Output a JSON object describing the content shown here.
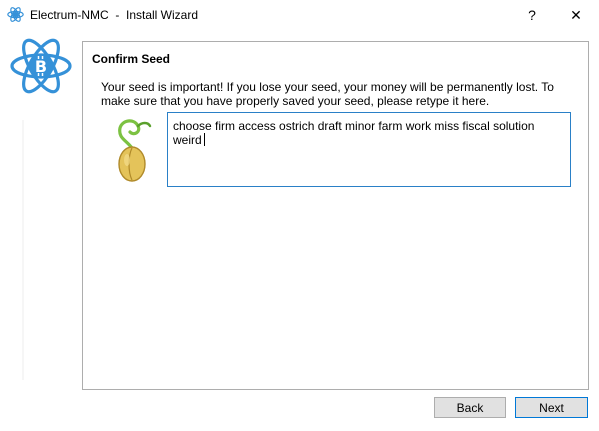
{
  "window": {
    "title": "Electrum-NMC  -  Install Wizard",
    "help_glyph": "?",
    "close_glyph": "✕",
    "icon": "electrum-atom-icon"
  },
  "sidebar": {
    "logo": "electrum-bitcoin-logo"
  },
  "page": {
    "title": "Confirm Seed",
    "message": "Your seed is important! If you lose your seed, your money will be permanently lost. To make sure that you have properly saved your seed, please retype it here.",
    "seed_icon": "seed-sprout-icon",
    "seed_value": "choose firm access ostrich draft minor farm work miss fiscal solution weird"
  },
  "buttons": {
    "back": "Back",
    "next": "Next"
  },
  "colors": {
    "accent": "#2a80c7",
    "logo_blue": "#3591d8",
    "focus_border": "#0078d7"
  }
}
